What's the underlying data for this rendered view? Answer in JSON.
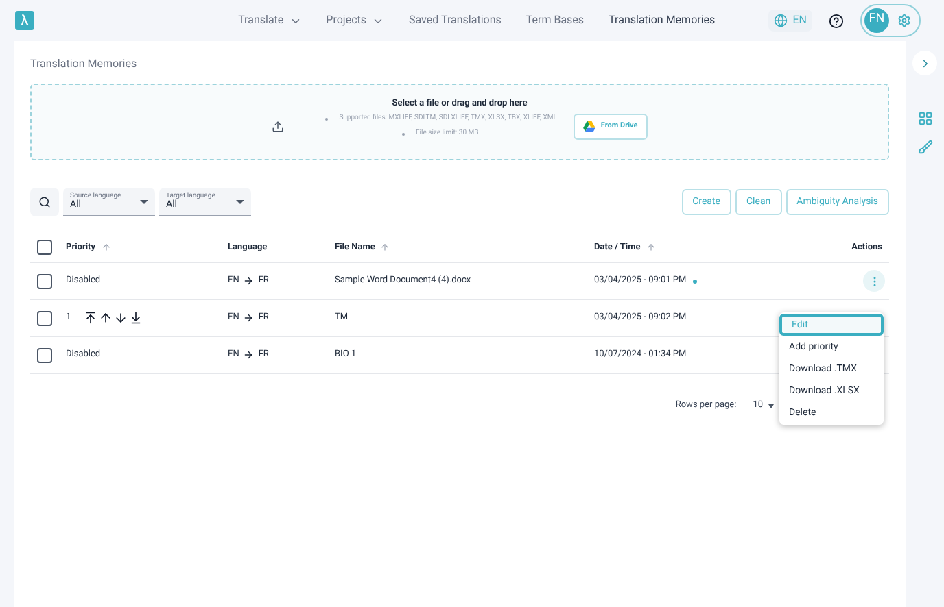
{
  "nav": {
    "logo": "λ",
    "items": [
      {
        "label": "Translate",
        "dropdown": true,
        "selected": false
      },
      {
        "label": "Projects",
        "dropdown": true,
        "selected": false
      },
      {
        "label": "Saved Translations",
        "dropdown": false,
        "selected": false
      },
      {
        "label": "Term Bases",
        "dropdown": false,
        "selected": false
      },
      {
        "label": "Translation Memories",
        "dropdown": false,
        "selected": true
      }
    ],
    "language": "EN",
    "avatar": "FN"
  },
  "page_title": "Translation Memories",
  "upload": {
    "title": "Select a file or drag and drop here",
    "notes": [
      "Supported files: MXLIFF, SDLTM, SDLXLIFF, TMX, XLSX, TBX, XLIFF, XML",
      "File size limit: 30 MB."
    ],
    "drive_button": "From Drive"
  },
  "filters": [
    {
      "label": "Source language",
      "value": "All"
    },
    {
      "label": "Target language",
      "value": "All"
    }
  ],
  "actions": [
    "Create",
    "Clean",
    "Ambiguity Analysis"
  ],
  "table": {
    "select_all_checked": false,
    "columns": [
      {
        "label": "Priority",
        "sortable": true
      },
      {
        "label": "Language",
        "sortable": false
      },
      {
        "label": "File Name",
        "sortable": true
      },
      {
        "label": "Date / Time",
        "sortable": true
      },
      {
        "label": "Actions",
        "sortable": false
      }
    ],
    "rows": [
      {
        "priority": "Disabled",
        "kind": "text",
        "source": "EN",
        "target": "FR",
        "file": "Sample Word Document4 (4).docx",
        "date": "03/04/2025 - 09:01 PM",
        "new": true,
        "checked": false,
        "menu_open": true
      },
      {
        "priority": "1",
        "kind": "ordered",
        "source": "EN",
        "target": "FR",
        "file": "TM",
        "date": "03/04/2025 - 09:02 PM",
        "new": false,
        "checked": false,
        "menu_open": false
      },
      {
        "priority": "Disabled",
        "kind": "text",
        "source": "EN",
        "target": "FR",
        "file": "BIO 1",
        "date": "10/07/2024 - 01:34 PM",
        "new": false,
        "checked": false,
        "menu_open": false
      }
    ]
  },
  "menu": [
    {
      "label": "Edit",
      "selected": true
    },
    {
      "label": "Add priority",
      "selected": false
    },
    {
      "label": "Download .TMX",
      "selected": false
    },
    {
      "label": "Download .XLSX",
      "selected": false
    },
    {
      "label": "Delete",
      "selected": false
    }
  ],
  "pagination": {
    "label": "Rows per page:",
    "value": "10"
  }
}
